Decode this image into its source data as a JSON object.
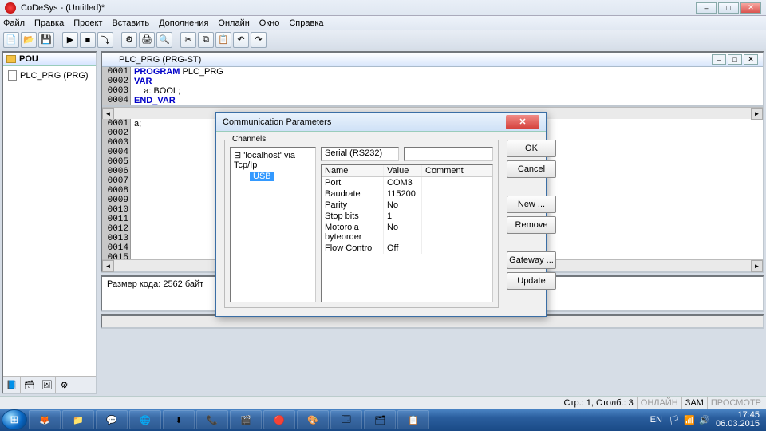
{
  "window": {
    "title": "CoDeSys - (Untitled)*"
  },
  "menu": {
    "file": "Файл",
    "edit": "Правка",
    "project": "Проект",
    "insert": "Вставить",
    "extras": "Дополнения",
    "online": "Онлайн",
    "window": "Окно",
    "help": "Справка"
  },
  "left": {
    "tab": "POU",
    "item": "PLC_PRG (PRG)"
  },
  "code": {
    "title": "PLC_PRG (PRG-ST)",
    "lines_top": [
      {
        "n": "0001",
        "pre": "PROGRAM",
        "rest": " PLC_PRG"
      },
      {
        "n": "0002",
        "pre": "VAR",
        "rest": ""
      },
      {
        "n": "0003",
        "pre": "",
        "rest": "    a: BOOL;"
      },
      {
        "n": "0004",
        "pre": "END_VAR",
        "rest": ""
      }
    ],
    "lines_bottom": [
      {
        "n": "0001",
        "t": "a;"
      },
      {
        "n": "0002",
        "t": ""
      },
      {
        "n": "0003",
        "t": ""
      },
      {
        "n": "0004",
        "t": ""
      },
      {
        "n": "0005",
        "t": ""
      },
      {
        "n": "0006",
        "t": ""
      },
      {
        "n": "0007",
        "t": ""
      },
      {
        "n": "0008",
        "t": ""
      },
      {
        "n": "0009",
        "t": ""
      },
      {
        "n": "0010",
        "t": ""
      },
      {
        "n": "0011",
        "t": ""
      },
      {
        "n": "0012",
        "t": ""
      },
      {
        "n": "0013",
        "t": ""
      },
      {
        "n": "0014",
        "t": ""
      },
      {
        "n": "0015",
        "t": ""
      }
    ]
  },
  "status_msg": "Размер кода: 2562 байт",
  "statusbar": {
    "pos": "Стр.: 1, Столб.: 3",
    "online": "ОНЛАЙН",
    "zam": "ЗАМ",
    "view": "ПРОСМОТР"
  },
  "dialog": {
    "title": "Communication Parameters",
    "channels_label": "Channels",
    "root": "'localhost' via Tcp/Ip",
    "selected": "USB",
    "conn_type": "Serial (RS232)",
    "cols": {
      "name": "Name",
      "value": "Value",
      "comment": "Comment"
    },
    "params": [
      {
        "name": "Port",
        "value": "COM3"
      },
      {
        "name": "Baudrate",
        "value": "115200"
      },
      {
        "name": "Parity",
        "value": "No"
      },
      {
        "name": "Stop bits",
        "value": "1"
      },
      {
        "name": "Motorola byteorder",
        "value": "No"
      },
      {
        "name": "Flow Control",
        "value": "Off"
      }
    ],
    "btn": {
      "ok": "OK",
      "cancel": "Cancel",
      "new_": "New ...",
      "remove": "Remove",
      "gateway": "Gateway ...",
      "update": "Update"
    }
  },
  "tray": {
    "lang": "EN",
    "time": "17:45",
    "date": "06.03.2015"
  }
}
